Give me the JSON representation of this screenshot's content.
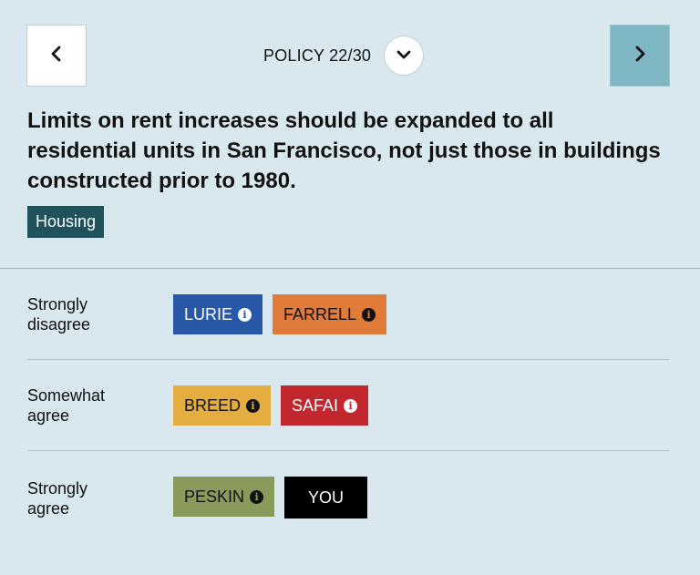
{
  "nav": {
    "prev_icon": "chevron-left-icon",
    "next_icon": "chevron-right-icon",
    "counter_label": "POLICY 22/30",
    "dropdown_icon": "chevron-down-icon"
  },
  "policy": {
    "statement": "Limits on rent increases should be expanded to all residential units in San Francisco, not just those in buildings constructed prior to 1980.",
    "topic": "Housing"
  },
  "rows": [
    {
      "label_line1": "Strongly",
      "label_line2": "disagree",
      "chips": [
        {
          "name": "LURIE",
          "info": "i",
          "bg": "#2a58a8",
          "fg": "#ffffff"
        },
        {
          "name": "FARRELL",
          "info": "i",
          "bg": "#e07b39",
          "fg": "#111111"
        }
      ]
    },
    {
      "label_line1": "Somewhat",
      "label_line2": "agree",
      "chips": [
        {
          "name": "BREED",
          "info": "i",
          "bg": "#e5ac3f",
          "fg": "#111111"
        },
        {
          "name": "SAFAI",
          "info": "i",
          "bg": "#c1272d",
          "fg": "#ffffff"
        }
      ]
    },
    {
      "label_line1": "Strongly",
      "label_line2": "agree",
      "chips": [
        {
          "name": "PESKIN",
          "info": "i",
          "bg": "#8a9a5b",
          "fg": "#111111"
        },
        {
          "name": "YOU",
          "info": "",
          "bg": "#000000",
          "fg": "#ffffff"
        }
      ]
    }
  ],
  "colors": {
    "background": "#d8e8ee",
    "next_button": "#7fb6c3",
    "topic_tag": "#1f525b"
  }
}
